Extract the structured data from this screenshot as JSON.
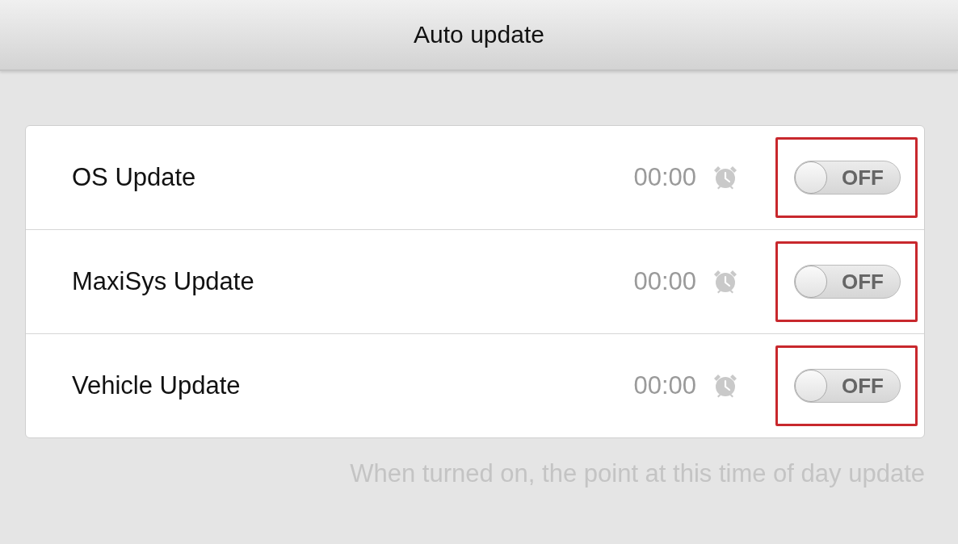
{
  "header": {
    "title": "Auto update"
  },
  "settings": [
    {
      "label": "OS Update",
      "time": "00:00",
      "switch": {
        "text": "OFF",
        "on": false
      },
      "highlighted": true
    },
    {
      "label": "MaxiSys Update",
      "time": "00:00",
      "switch": {
        "text": "OFF",
        "on": false
      },
      "highlighted": true
    },
    {
      "label": "Vehicle Update",
      "time": "00:00",
      "switch": {
        "text": "OFF",
        "on": false
      },
      "highlighted": true
    }
  ],
  "hint": "When turned on, the point at this time of day update"
}
